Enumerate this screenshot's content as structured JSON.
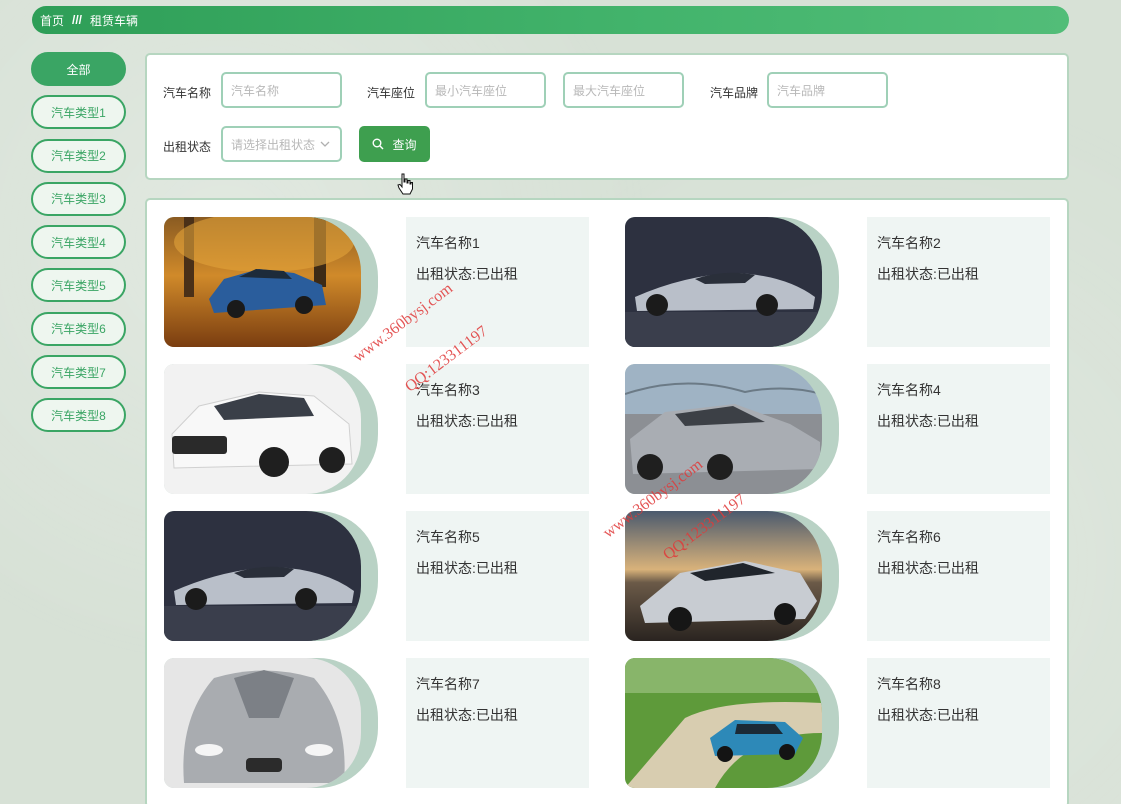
{
  "breadcrumb": {
    "home": "首页",
    "separator": "///",
    "current": "租赁车辆"
  },
  "sidebar": {
    "items": [
      {
        "label": "全部",
        "active": true
      },
      {
        "label": "汽车类型1"
      },
      {
        "label": "汽车类型2"
      },
      {
        "label": "汽车类型3"
      },
      {
        "label": "汽车类型4"
      },
      {
        "label": "汽车类型5"
      },
      {
        "label": "汽车类型6"
      },
      {
        "label": "汽车类型7"
      },
      {
        "label": "汽车类型8"
      }
    ]
  },
  "search": {
    "name_label": "汽车名称",
    "name_placeholder": "汽车名称",
    "seat_label": "汽车座位",
    "seat_min_placeholder": "最小汽车座位",
    "seat_max_placeholder": "最大汽车座位",
    "brand_label": "汽车品牌",
    "brand_placeholder": "汽车品牌",
    "status_label": "出租状态",
    "status_placeholder": "请选择出租状态",
    "query_label": "查询"
  },
  "cars": [
    {
      "name": "汽车名称1",
      "status": "出租状态:已出租",
      "image": "orange-autumn-sports-car"
    },
    {
      "name": "汽车名称2",
      "status": "出租状态:已出租",
      "image": "silver-supercar-dark"
    },
    {
      "name": "汽车名称3",
      "status": "出租状态:已出租",
      "image": "white-suv"
    },
    {
      "name": "汽车名称4",
      "status": "出租状态:已出租",
      "image": "silver-sedan-bridge"
    },
    {
      "name": "汽车名称5",
      "status": "出租状态:已出租",
      "image": "silver-supercar-dark"
    },
    {
      "name": "汽车名称6",
      "status": "出租状态:已出租",
      "image": "concept-car-sunset"
    },
    {
      "name": "汽车名称7",
      "status": "出租状态:已出租",
      "image": "silver-concept-car-front"
    },
    {
      "name": "汽车名称8",
      "status": "出租状态:已出租",
      "image": "blue-roadster-road"
    }
  ],
  "watermarks": [
    {
      "text": "www.360bysj.com"
    },
    {
      "text": "QQ:123311197"
    },
    {
      "text": "www.360bysj.com"
    },
    {
      "text": "QQ:123311197"
    }
  ],
  "colors": {
    "accent": "#3aa564",
    "query_button": "#3e9f4f",
    "watermark": "#e03a3a"
  }
}
